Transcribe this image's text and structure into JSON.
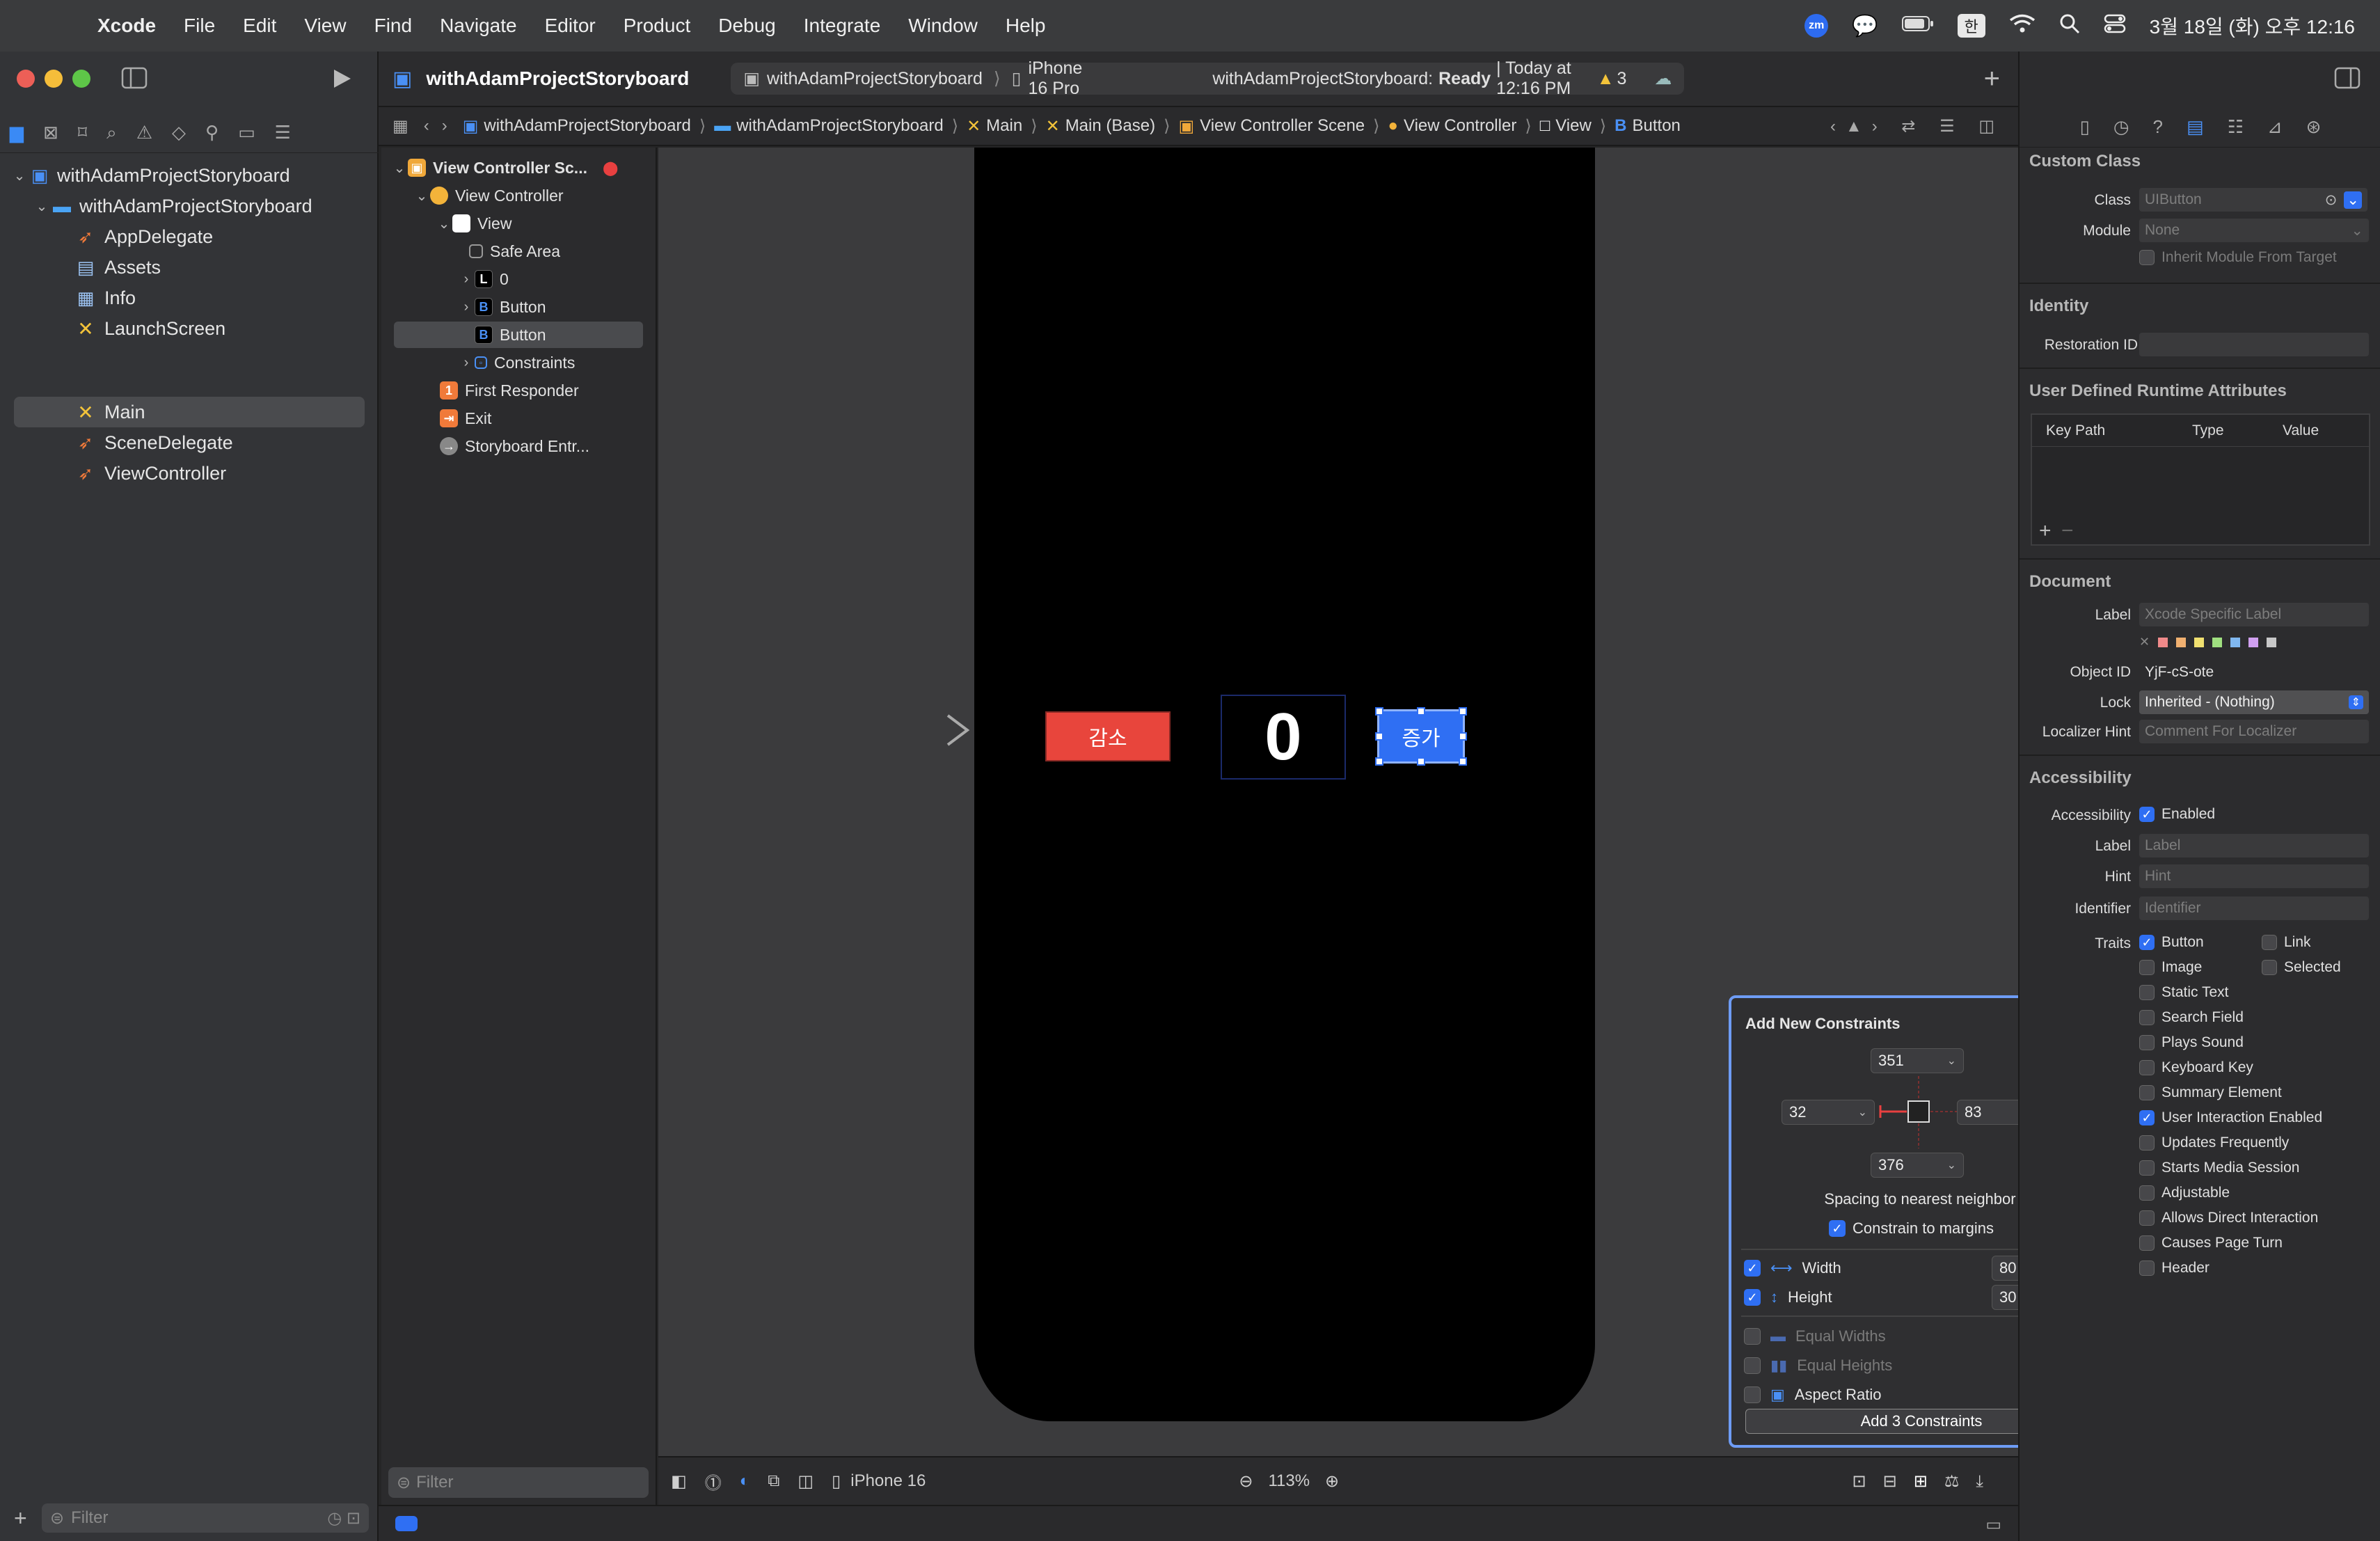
{
  "menubar": {
    "app": "Xcode",
    "items": [
      "File",
      "Edit",
      "View",
      "Find",
      "Navigate",
      "Editor",
      "Product",
      "Debug",
      "Integrate",
      "Window",
      "Help"
    ],
    "zoom_badge": "zm",
    "input_method": "한",
    "clock": "3월 18일 (화) 오후 12:16"
  },
  "navigator": {
    "project": "withAdamProjectStoryboard",
    "group": "withAdamProjectStoryboard",
    "files": [
      {
        "name": "AppDelegate",
        "icon": "swift-file-icon"
      },
      {
        "name": "Assets",
        "icon": "assets-icon"
      },
      {
        "name": "Info",
        "icon": "plist-icon"
      },
      {
        "name": "LaunchScreen",
        "icon": "storyboard-icon"
      },
      {
        "name": "Main",
        "icon": "storyboard-icon"
      },
      {
        "name": "SceneDelegate",
        "icon": "swift-file-icon"
      },
      {
        "name": "ViewController",
        "icon": "swift-file-icon"
      }
    ],
    "selected": "Main",
    "filter_placeholder": "Filter"
  },
  "toolbar": {
    "title": "withAdamProjectStoryboard",
    "scheme": "withAdamProjectStoryboard",
    "destination": "iPhone 16 Pro",
    "status_name": "withAdamProjectStoryboard:",
    "status_state": "Ready",
    "status_time": "| Today at 12:16 PM",
    "warnings": "3"
  },
  "jumpbar": {
    "crumbs": [
      "withAdamProjectStoryboard",
      "withAdamProjectStoryboard",
      "Main",
      "Main (Base)",
      "View Controller Scene",
      "View Controller",
      "View",
      "Button"
    ]
  },
  "outline": {
    "scene": "View Controller Sc...",
    "view_controller": "View Controller",
    "view": "View",
    "safe_area": "Safe Area",
    "label_zero": "0",
    "button1": "Button",
    "button2": "Button",
    "constraints": "Constraints",
    "first_responder": "First Responder",
    "exit": "Exit",
    "storyboard_entry": "Storyboard Entr...",
    "filter_placeholder": "Filter"
  },
  "canvas": {
    "decrease_label": "감소",
    "counter_label": "0",
    "increase_label": "증가",
    "device": "iPhone 16",
    "zoom": "113%"
  },
  "constraints_popover": {
    "title": "Add New Constraints",
    "top": "351",
    "leading": "32",
    "trailing": "83",
    "bottom": "376",
    "spacing_caption": "Spacing to nearest neighbor",
    "constrain_margins": "Constrain to margins",
    "width_label": "Width",
    "width_value": "80",
    "height_label": "Height",
    "height_value": "30",
    "equal_widths": "Equal Widths",
    "equal_heights": "Equal Heights",
    "aspect_ratio": "Aspect Ratio",
    "add_button": "Add 3 Constraints"
  },
  "inspector": {
    "custom_class_head": "Custom Class",
    "class_label": "Class",
    "class_placeholder": "UIButton",
    "module_label": "Module",
    "module_placeholder": "None",
    "inherit_module": "Inherit Module From Target",
    "identity_head": "Identity",
    "restoration_label": "Restoration ID",
    "udra_head": "User Defined Runtime Attributes",
    "col_keypath": "Key Path",
    "col_type": "Type",
    "col_value": "Value",
    "document_head": "Document",
    "doc_label_label": "Label",
    "doc_label_placeholder": "Xcode Specific Label",
    "object_id_label": "Object ID",
    "object_id": "YjF-cS-ote",
    "lock_label": "Lock",
    "lock_value": "Inherited - (Nothing)",
    "localizer_label": "Localizer Hint",
    "localizer_placeholder": "Comment For Localizer",
    "accessibility_head": "Accessibility",
    "acc_label": "Accessibility",
    "acc_enabled": "Enabled",
    "acc_label_label": "Label",
    "acc_label_placeholder": "Label",
    "hint_label": "Hint",
    "hint_placeholder": "Hint",
    "identifier_label": "Identifier",
    "identifier_placeholder": "Identifier",
    "traits_label": "Traits",
    "traits": [
      {
        "name": "Button",
        "checked": true
      },
      {
        "name": "Image",
        "checked": false
      },
      {
        "name": "Static Text",
        "checked": false
      },
      {
        "name": "Search Field",
        "checked": false
      },
      {
        "name": "Plays Sound",
        "checked": false
      },
      {
        "name": "Keyboard Key",
        "checked": false
      },
      {
        "name": "Summary Element",
        "checked": false
      },
      {
        "name": "User Interaction Enabled",
        "checked": true
      },
      {
        "name": "Updates Frequently",
        "checked": false
      },
      {
        "name": "Starts Media Session",
        "checked": false
      },
      {
        "name": "Adjustable",
        "checked": false
      },
      {
        "name": "Allows Direct Interaction",
        "checked": false
      },
      {
        "name": "Causes Page Turn",
        "checked": false
      },
      {
        "name": "Header",
        "checked": false
      }
    ],
    "traits_right": [
      {
        "name": "Link",
        "checked": false
      },
      {
        "name": "Selected",
        "checked": false
      }
    ]
  }
}
